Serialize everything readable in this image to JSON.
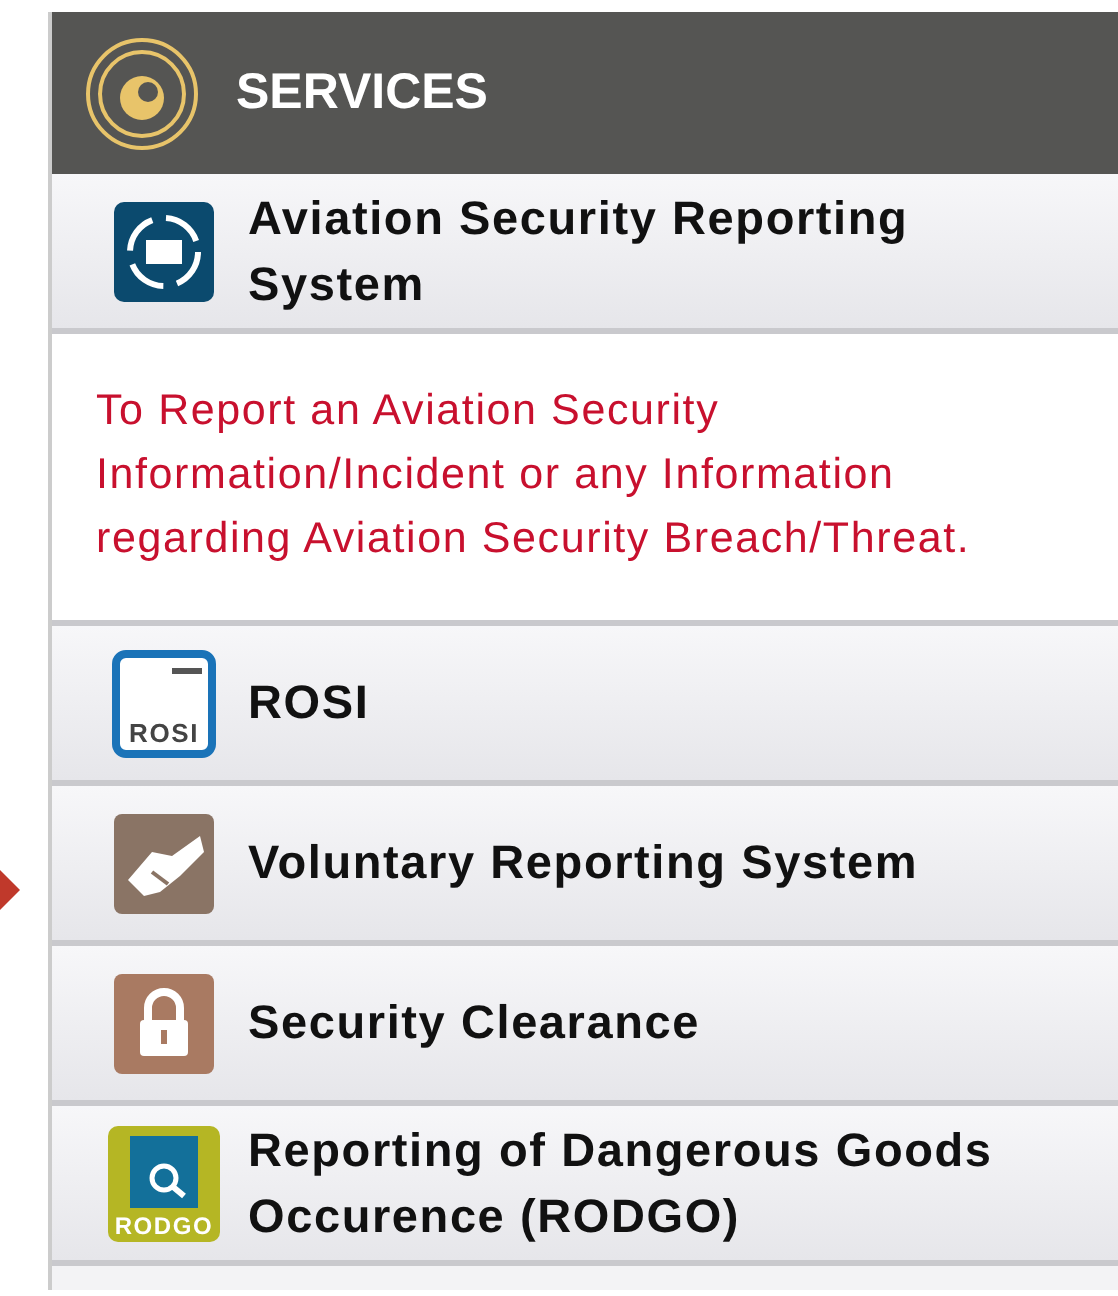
{
  "panel": {
    "title": "SERVICES"
  },
  "items": [
    {
      "kind": "link",
      "label": "Aviation Security Reporting System"
    },
    {
      "kind": "note",
      "text": "To Report an Aviation Security Information/Incident or any Information regarding Aviation Security Breach/Threat."
    },
    {
      "kind": "link",
      "label": "ROSI",
      "icon_label": "ROSI"
    },
    {
      "kind": "link",
      "label": "Voluntary Reporting System"
    },
    {
      "kind": "link",
      "label": "Security Clearance"
    },
    {
      "kind": "link",
      "label": "Reporting of Dangerous Goods Occurence (RODGO)",
      "icon_label": "RODGO"
    }
  ]
}
